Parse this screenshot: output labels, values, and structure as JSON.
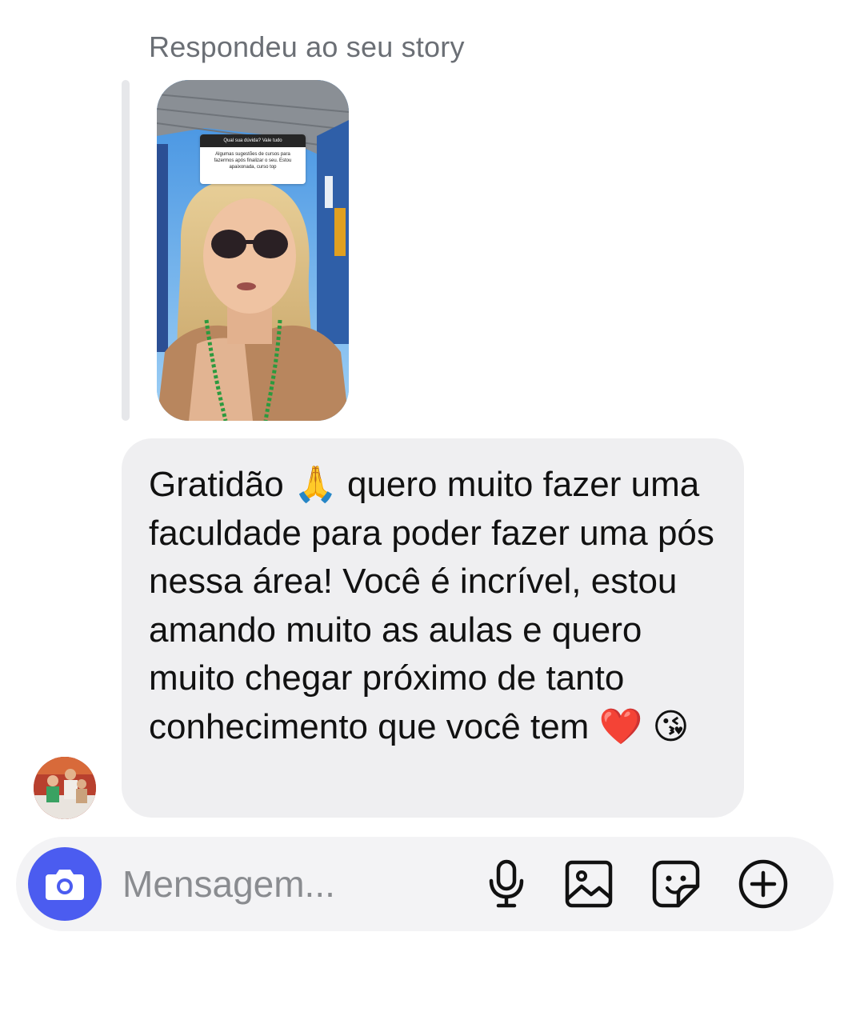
{
  "reply_header": {
    "label": "Respondeu ao seu story"
  },
  "story": {
    "question_title": "Qual sua dúvida? Vale tudo",
    "question_answer": "Algumas sugestões de cursos para fazermos após finalizar o seu. Estou apaixonada, curso top"
  },
  "message": {
    "text": "Gratidão 🙏 quero muito fazer uma faculdade para poder fazer uma pós nessa área! Você é incrível, estou amando muito as aulas e quero muito chegar próximo de tanto conhecimento que você tem ❤️ 😘"
  },
  "composer": {
    "placeholder": "Mensagem...",
    "accent_color": "#4b5cf0",
    "icons": [
      "camera-icon",
      "microphone-icon",
      "gallery-icon",
      "sticker-icon",
      "plus-circle-icon"
    ]
  }
}
